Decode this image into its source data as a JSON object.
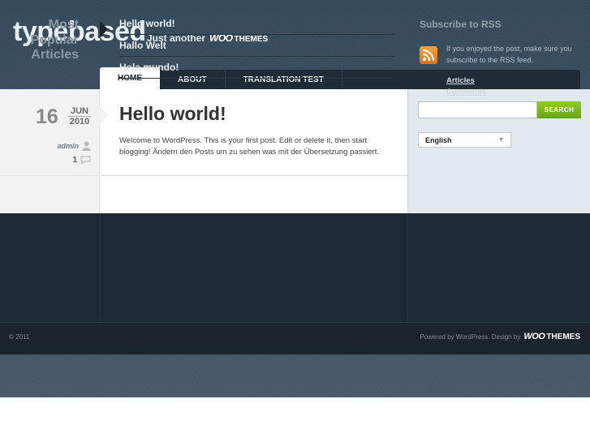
{
  "header": {
    "site_title": "typebased",
    "tagline": "Just another",
    "tagline_logo_woo": "WOO",
    "tagline_logo_themes": "THEMES"
  },
  "nav": {
    "items": [
      {
        "label": "HOME",
        "active": true
      },
      {
        "label": "ABOUT",
        "active": false
      },
      {
        "label": "TRANSLATION TEST",
        "active": false
      }
    ]
  },
  "post": {
    "day": "16",
    "month": "JUN",
    "year": "2010",
    "author": "admin",
    "comment_count": "1",
    "title": "Hello world!",
    "body": "Welcome to WordPress. This is your first post. Edit or delete it, then start blogging!  Ändern den Posts um zu sehen was mit der Übersetzung passiert."
  },
  "sidebar": {
    "search_value": "",
    "search_button": "SEARCH",
    "language_selected": "English"
  },
  "popular": {
    "heading": "Most Popular Articles",
    "items": [
      "Hello world!",
      "Hallo Welt",
      "Hola mundo!"
    ]
  },
  "rss": {
    "heading": "Subscribe to RSS",
    "text": "If you enjoyed the post, make sure you subscribe to the RSS feed.",
    "articles_link": "Articles",
    "comments_link": "Comments"
  },
  "footer": {
    "copyright": "© 2011",
    "credits": "Powered by WordPress. Design by",
    "credits_logo_woo": "WOO",
    "credits_logo_themes": "THEMES"
  },
  "colors": {
    "accent_green": "#7ab51d",
    "rss_orange": "#f08a24",
    "dark_band": "#1d2933"
  }
}
